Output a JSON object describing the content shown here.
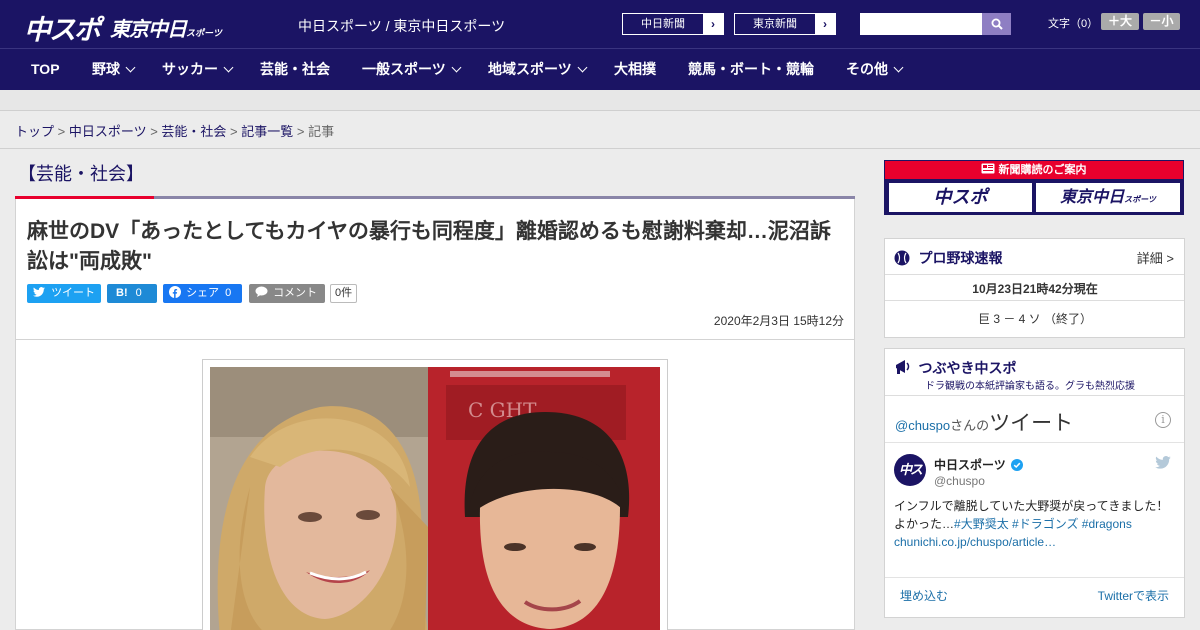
{
  "header": {
    "logo_chuspo": "中スポ",
    "logo_tokyo": "東京中日",
    "logo_tokyo_small": "スポーツ",
    "site_links": "中日スポーツ / 東京中日スポーツ",
    "chunichi_btn": "中日新聞",
    "tokyo_btn": "東京新聞",
    "search_placeholder": "",
    "font_label": "文字（0）",
    "font_larger": "＋大",
    "font_smaller": "－小"
  },
  "nav": [
    {
      "label": "TOP"
    },
    {
      "label": "野球"
    },
    {
      "label": "サッカー"
    },
    {
      "label": "芸能・社会"
    },
    {
      "label": "一般スポーツ"
    },
    {
      "label": "地域スポーツ"
    },
    {
      "label": "大相撲"
    },
    {
      "label": "競馬・ボート・競輪"
    },
    {
      "label": "その他"
    }
  ],
  "breadcrumb": {
    "top": "トップ",
    "chunichi": "中日スポーツ",
    "category": "芸能・社会",
    "list": "記事一覧",
    "current": "記事",
    "sep": " > "
  },
  "article": {
    "category": "【芸能・社会】",
    "title": "麻世のDV「あったとしてもカイヤの暴行も同程度」離婚認めるも慰謝料棄却…泥沼訴訟は\"両成敗\"",
    "tweet_label": "ツイート",
    "hatena_label": "B!",
    "hatena_count": "0",
    "fb_label": "シェア",
    "fb_count": "0",
    "comment_label": "コメント",
    "comment_count": "0件",
    "date": "2020年2月3日 15時12分"
  },
  "sidebar": {
    "subscribe_header": "新聞購読のご案内",
    "subscribe_chuspo": "中スポ",
    "subscribe_tokyo": "東京中日",
    "subscribe_tokyo_small": "スポーツ",
    "baseball_title": "プロ野球速報",
    "baseball_detail": "詳細 >",
    "baseball_time": "10月23日21時42分現在",
    "baseball_score": "巨 3 － 4 ソ （終了）",
    "tweets_title": "つぶやき中スポ",
    "tweets_subtitle": "ドラ観戦の本紙評論家も語る。グラも熱烈応援",
    "tweets_account": "@chuspo",
    "tweets_account_suffix": "さんの",
    "tweets_label": "ツイート",
    "tweet_name": "中日スポーツ",
    "tweet_handle": "@chuspo",
    "tweet_text": "インフルで離脱していた大野奨が戻ってきました！",
    "tweet_text2": "よかった…",
    "tweet_tags": "#大野奨太 #ドラゴンズ #dragons",
    "tweet_link": "chunichi.co.jp/chuspo/article…",
    "embed_label": "埋め込む",
    "view_twitter": "Twitterで表示"
  },
  "colors": {
    "brand": "#1b1464",
    "accent": "#e8002d",
    "twitter": "#1da1f2"
  }
}
